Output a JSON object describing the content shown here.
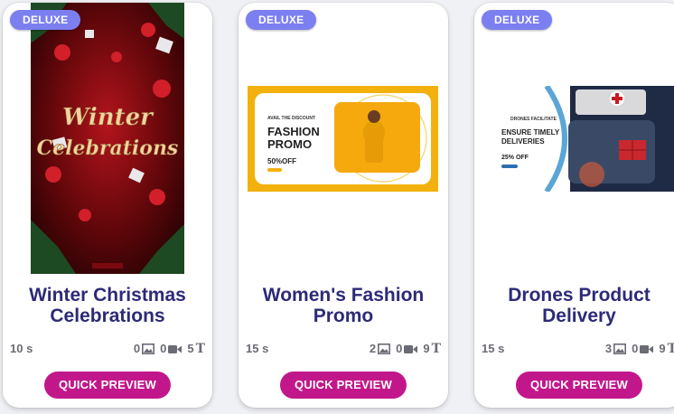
{
  "cards": [
    {
      "badge": "DELUXE",
      "title": "Winter Christmas Celebrations",
      "duration": "10 s",
      "images": "0",
      "videos": "0",
      "texts": "5",
      "button": "QUICK PREVIEW",
      "thumb_text": [
        "Winter",
        "Celebrations"
      ]
    },
    {
      "badge": "DELUXE",
      "title": "Women's Fashion Promo",
      "duration": "15 s",
      "images": "2",
      "videos": "0",
      "texts": "9",
      "button": "QUICK PREVIEW",
      "thumb_text": [
        "AVAIL THE DISCOUNT",
        "FASHION",
        "PROMO",
        "50%OFF"
      ]
    },
    {
      "badge": "DELUXE",
      "title": "Drones Product Delivery",
      "duration": "15 s",
      "images": "3",
      "videos": "0",
      "texts": "9",
      "button": "QUICK PREVIEW",
      "thumb_text": [
        "DRONES FACILITATE",
        "ENSURE TIMELY",
        "DELIVERIES",
        "25% OFF"
      ]
    }
  ],
  "colors": {
    "badge": "#7b7ff0",
    "title": "#2d2a78",
    "button": "#c2178b",
    "meta": "#6b6b76"
  },
  "icons": {
    "images": "image-icon",
    "videos": "video-camera-icon",
    "texts": "text-icon"
  }
}
